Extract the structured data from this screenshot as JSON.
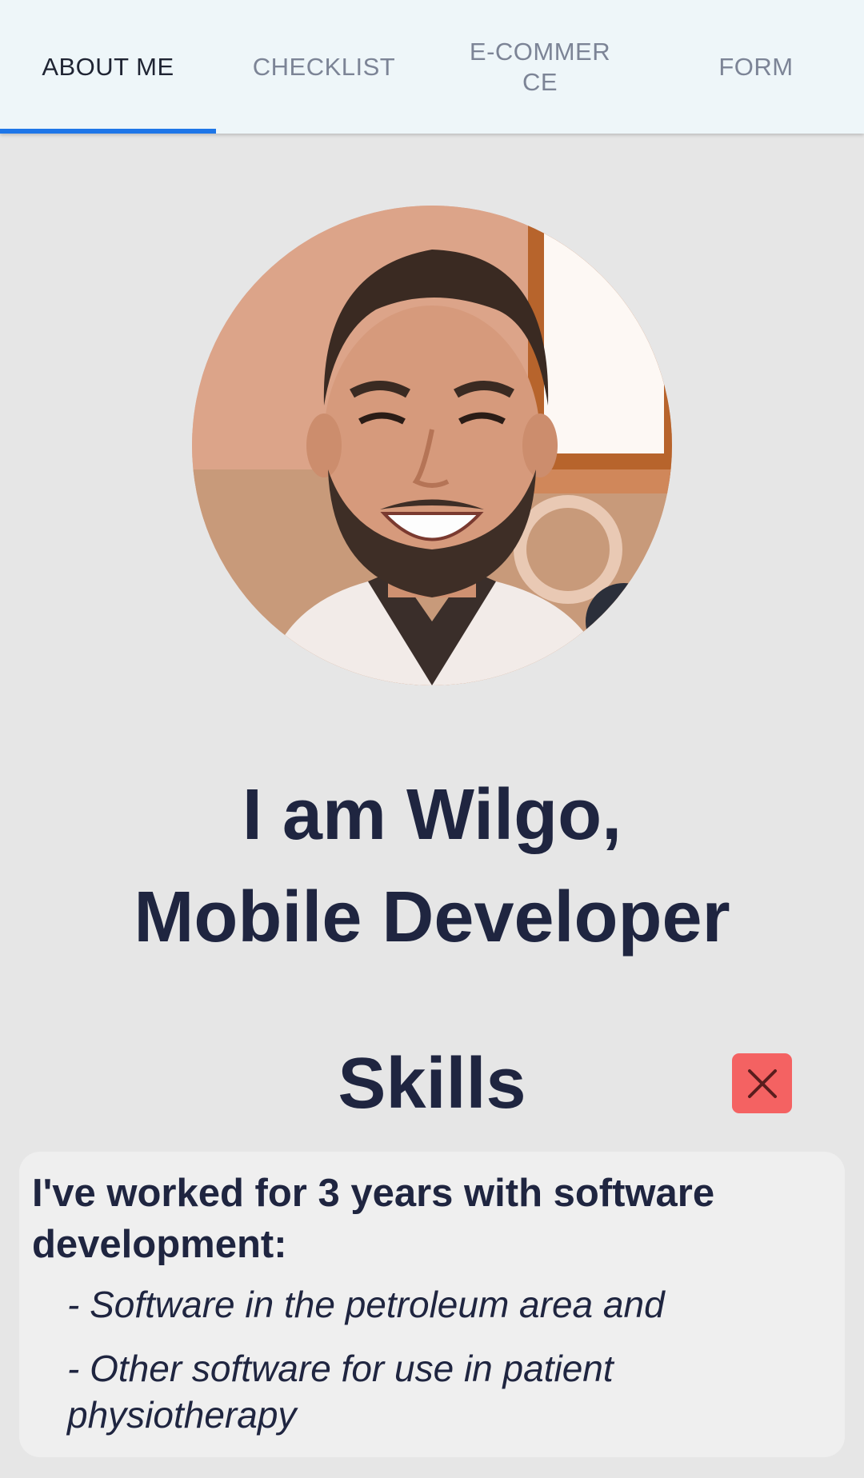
{
  "tabs": [
    {
      "label": "ABOUT ME",
      "active": true
    },
    {
      "label": "CHECKLIST",
      "active": false
    },
    {
      "label": "E-COMMERCE",
      "active": false
    },
    {
      "label": "FORM",
      "active": false
    }
  ],
  "profile": {
    "avatar_icon": "profile-photo",
    "headline_line1": "I am Wilgo,",
    "headline_line2": "Mobile Developer"
  },
  "skills": {
    "title": "Skills",
    "close_icon": "close-icon",
    "intro": "I've worked for 3 years with software development:",
    "items": [
      "- Software in the petroleum area and",
      "- Other software for use in patient physiotherapy"
    ]
  },
  "colors": {
    "accent": "#1e76e8",
    "heading": "#1f2540",
    "close_button": "#f46262",
    "tabbar_bg": "#eef6f9",
    "page_bg": "#e6e6e6"
  }
}
